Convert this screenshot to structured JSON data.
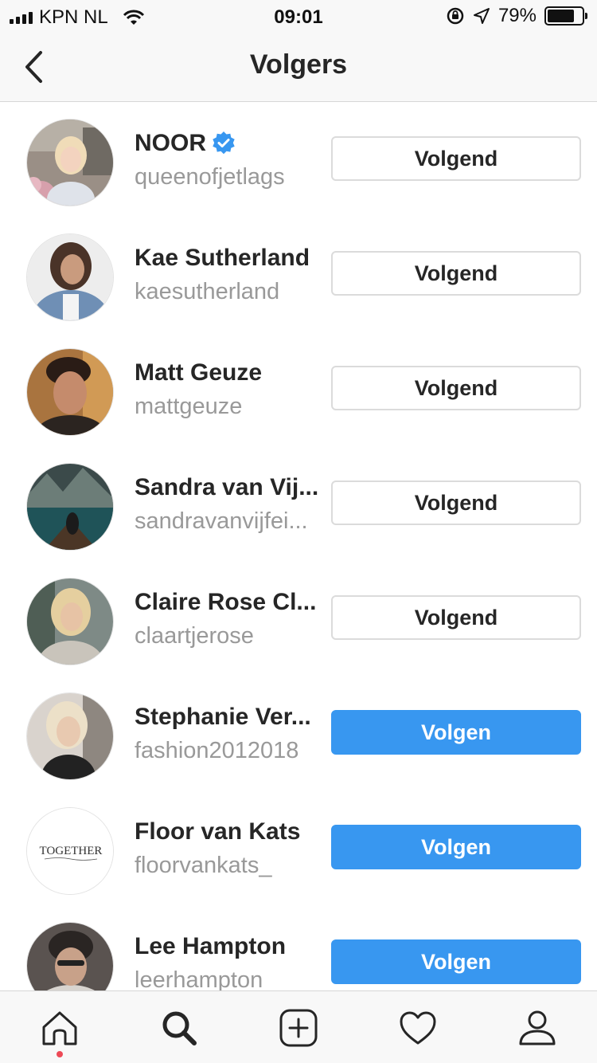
{
  "status_bar": {
    "carrier": "KPN NL",
    "time": "09:01",
    "battery_percent": "79%",
    "battery_level": 0.79
  },
  "header": {
    "title": "Volgers",
    "back_icon": "chevron-left-icon"
  },
  "followers": [
    {
      "display_name": "NOOR",
      "username": "queenofjetlags",
      "verified": true,
      "button": "Volgend",
      "following": true
    },
    {
      "display_name": "Kae Sutherland",
      "username": "kaesutherland",
      "verified": false,
      "button": "Volgend",
      "following": true
    },
    {
      "display_name": "Matt Geuze",
      "username": "mattgeuze",
      "verified": false,
      "button": "Volgend",
      "following": true
    },
    {
      "display_name": "Sandra van Vij...",
      "username": "sandravanvijfei...",
      "verified": false,
      "button": "Volgend",
      "following": true
    },
    {
      "display_name": "Claire Rose Cl...",
      "username": "claartjerose",
      "verified": false,
      "button": "Volgend",
      "following": true
    },
    {
      "display_name": "Stephanie Ver...",
      "username": "fashion2012018",
      "verified": false,
      "button": "Volgen",
      "following": false
    },
    {
      "display_name": "Floor van Kats",
      "username": "floorvankats_",
      "verified": false,
      "button": "Volgen",
      "following": false,
      "avatar_text": "TOGETHER"
    },
    {
      "display_name": "Lee Hampton",
      "username": "leerhampton",
      "verified": false,
      "button": "Volgen",
      "following": false
    }
  ],
  "tab_bar": {
    "tabs": [
      "home-icon",
      "search-icon",
      "add-post-icon",
      "heart-icon",
      "profile-icon"
    ],
    "home_has_notification": true
  },
  "colors": {
    "follow_blue": "#3897f0",
    "verified_blue": "#3897f0",
    "notification_red": "#ed4956",
    "username_gray": "#999999"
  }
}
